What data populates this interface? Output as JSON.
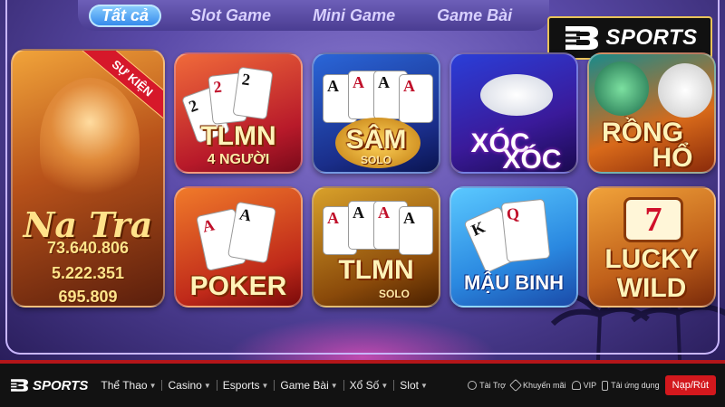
{
  "tabs": [
    {
      "label": "Tất cả",
      "active": true
    },
    {
      "label": "Slot Game",
      "active": false
    },
    {
      "label": "Mini Game",
      "active": false
    },
    {
      "label": "Game Bài",
      "active": false
    }
  ],
  "brand_badge": {
    "text": "SPORTS"
  },
  "featured": {
    "ribbon": "SỰ KIỆN",
    "title_script": "Na Tra",
    "values": [
      "73.640.806",
      "5.222.351",
      "695.809"
    ]
  },
  "games": [
    {
      "title": "TLMN",
      "subtitle": "4 NGƯỜI",
      "cards": [
        "2",
        "2",
        "2"
      ]
    },
    {
      "title": "SÂM",
      "subtitle": "SOLO",
      "cards": [
        "A",
        "A",
        "A",
        "A"
      ]
    },
    {
      "title": "XÓC",
      "subtitle": "XÓC"
    },
    {
      "title": "RỒNG",
      "subtitle": "HỔ"
    },
    {
      "title": "POKER",
      "cards": [
        "A",
        "A"
      ]
    },
    {
      "title": "TLMN",
      "subtitle": "SOLO",
      "cards": [
        "A",
        "A",
        "A",
        "A"
      ]
    },
    {
      "title": "MẬU BINH",
      "cards": [
        "K",
        "Q"
      ]
    },
    {
      "title": "LUCKY",
      "subtitle": "WILD",
      "reel": "7"
    }
  ],
  "nav": {
    "logo_text": "SPORTS",
    "menu": [
      "Thể Thao",
      "Casino",
      "Esports",
      "Game Bài",
      "Xổ Số",
      "Slot"
    ],
    "links": [
      "Tài Trợ",
      "Khuyến mãi",
      "VIP",
      "Tải ứng dụng"
    ],
    "cta": "Nạp/Rút"
  },
  "colors": {
    "accent": "#d3181d",
    "nav_bg": "#121212",
    "tab_active": "#2f85ea",
    "badge_border": "#e9c35a"
  }
}
